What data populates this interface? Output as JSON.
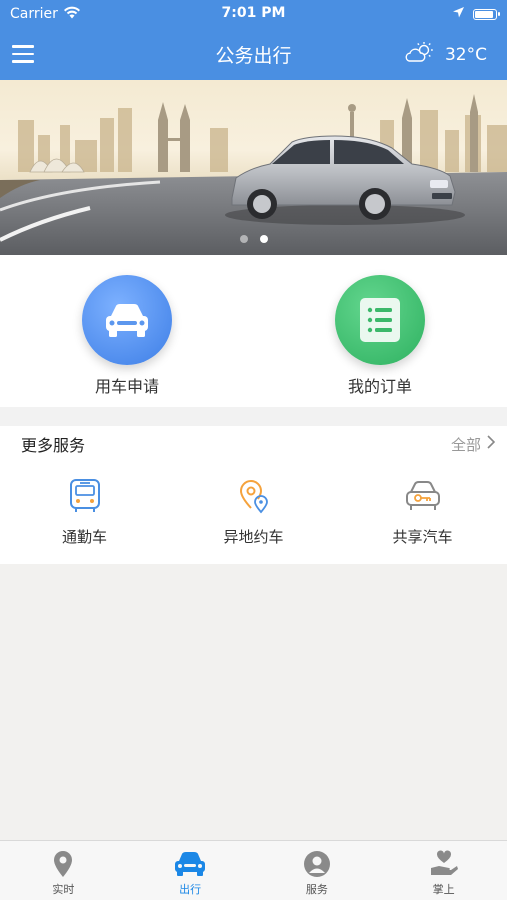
{
  "status_bar": {
    "carrier": "Carrier",
    "time": "7:01 PM"
  },
  "nav": {
    "title": "公务出行",
    "temperature": "32°C",
    "weather_icon": "partly-sunny-icon"
  },
  "banner": {
    "slide_count": 2,
    "active_slide": 2
  },
  "quick_actions": [
    {
      "label": "用车申请",
      "icon": "car-front-icon",
      "color": "#3d7ee6"
    },
    {
      "label": "我的订单",
      "icon": "list-doc-icon",
      "color": "#2eb160"
    }
  ],
  "more_services": {
    "title": "更多服务",
    "all_label": "全部",
    "items": [
      {
        "label": "通勤车",
        "icon": "bus-icon",
        "color": "#4a8fe2"
      },
      {
        "label": "异地约车",
        "icon": "location-pin-icon",
        "color": "#f5a23c"
      },
      {
        "label": "共享汽车",
        "icon": "car-key-icon",
        "color": "#888888"
      }
    ]
  },
  "tabs": [
    {
      "label": "实时",
      "icon": "map-pin-icon",
      "active": false
    },
    {
      "label": "出行",
      "icon": "car-icon",
      "active": true
    },
    {
      "label": "服务",
      "icon": "user-circle-icon",
      "active": false
    },
    {
      "label": "掌上",
      "icon": "hand-heart-icon",
      "active": false
    }
  ],
  "colors": {
    "header": "#4a8fe2",
    "tab_active": "#1b87e6",
    "tab_inactive": "#888888"
  }
}
